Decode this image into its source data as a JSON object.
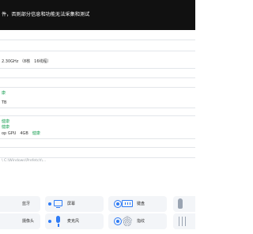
{
  "banner": {
    "text": "件，否则部分信息和功能无法采集和测试"
  },
  "rows": {
    "cpu": "2.30GHz （8核　16线程）",
    "storage_badge": "康",
    "disk": "TB",
    "gpu_health_1": "健康",
    "gpu_health_2": "健康",
    "gpu_prefix": "op GPU",
    "gpu_mem": "4GB",
    "gpu_status": "健康",
    "path": "\\ C:\\Windows\\Prefetch\\..."
  },
  "tests": [
    {
      "label": "蓝牙",
      "icon": "bluetooth-icon",
      "state": "tested"
    },
    {
      "label": "屏幕",
      "icon": "screen-icon",
      "state": "tested"
    },
    {
      "label": "键盘",
      "icon": "keyboard-icon",
      "state": "tested"
    },
    {
      "label": "",
      "icon": "touch-icon",
      "state": "disabled"
    },
    {
      "label": "摄像头",
      "icon": "camera-icon",
      "state": "tested"
    },
    {
      "label": "麦克风",
      "icon": "microphone-icon",
      "state": "tested"
    },
    {
      "label": "指纹",
      "icon": "fingerprint-icon",
      "state": "disabled"
    },
    {
      "label": "",
      "icon": "sliders-icon",
      "state": "disabled"
    }
  ],
  "colors": {
    "accent": "#2f7cf6",
    "healthy": "#22a35a",
    "banner_bg": "#111111",
    "tile_bg": "#f3f5f8",
    "disabled": "#9aa4b2"
  }
}
